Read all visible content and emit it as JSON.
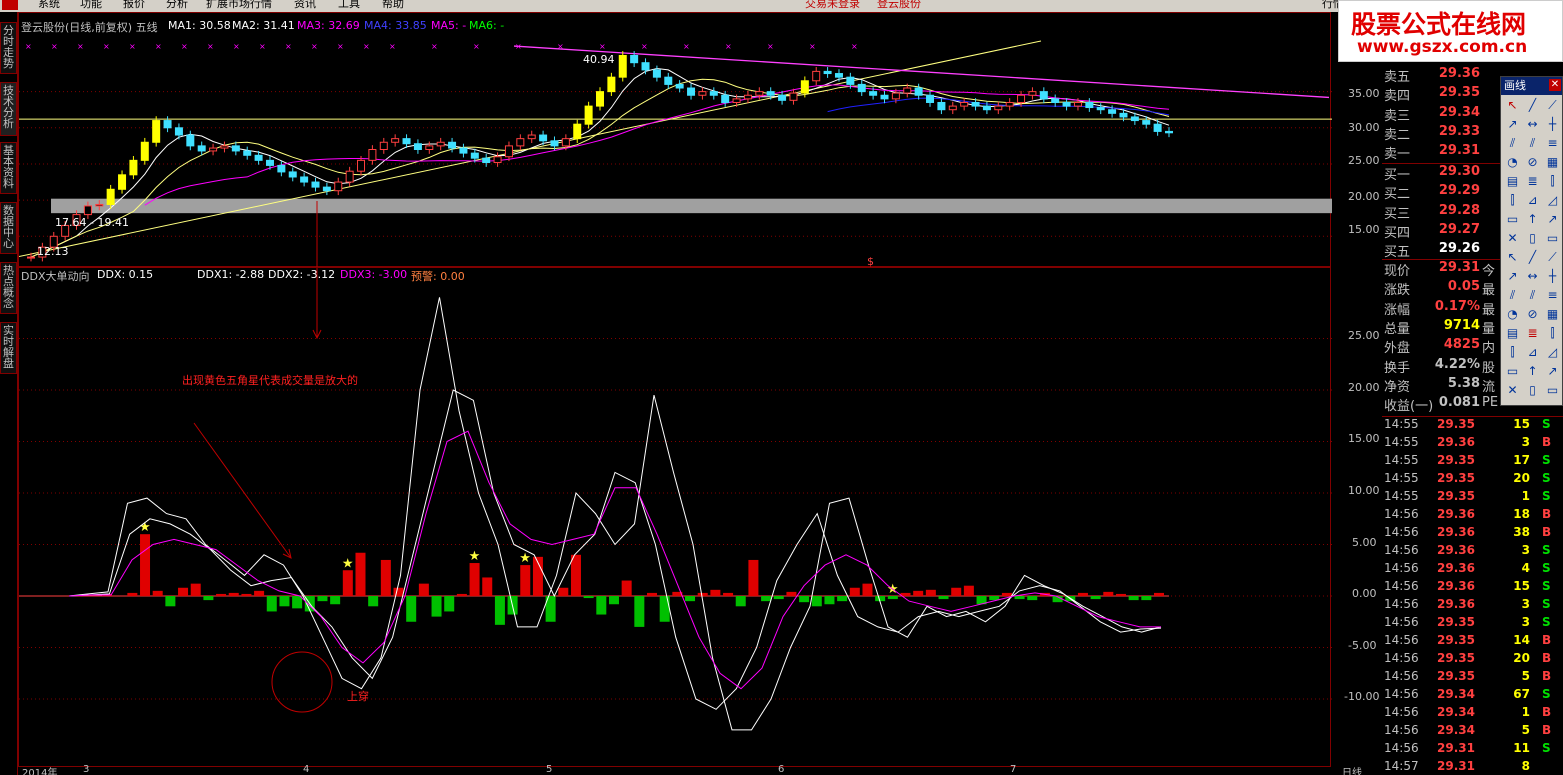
{
  "menu": [
    "系统",
    "功能",
    "报价",
    "分析",
    "扩展市场行情",
    "资讯",
    "工具",
    "帮助"
  ],
  "menu_center": [
    "交易未登录",
    "登云股份"
  ],
  "menu_right": "行情",
  "left_tabs": [
    "分时走势",
    "技术分析",
    "基本资料",
    "数据中心",
    "热点概念",
    "实时解盘"
  ],
  "main_chart": {
    "title": "登云股份(日线,前复权) 五线",
    "ma": [
      {
        "label": "MA1: 30.58",
        "color": "#ffffff"
      },
      {
        "label": "MA2: 31.41",
        "color": "#ffffff"
      },
      {
        "label": "MA3: 32.69",
        "color": "#ff00ff"
      },
      {
        "label": "MA4: 33.85",
        "color": "#0000ff"
      },
      {
        "label": "MA5: -",
        "color": "#ff00ff"
      },
      {
        "label": "MA6: -",
        "color": "#00ff00"
      }
    ],
    "y_ticks": [
      "35.00",
      "30.00",
      "25.00",
      "20.00",
      "15.00"
    ],
    "high_label": "40.94",
    "low_label": "12.13",
    "range_label_a": "17.64 - 19.41",
    "range_label_b": "20.00"
  },
  "indicator": {
    "name": "DDX大单动向",
    "ddx": "DDX: 0.15",
    "ddx1": "DDX1: -2.88",
    "ddx2": "DDX2: -3.12",
    "ddx3": "DDX3: -3.00",
    "warn": "预警: 0.00",
    "y_ticks": [
      "25.00",
      "20.00",
      "15.00",
      "10.00",
      "5.00",
      "0.00",
      "-5.00",
      "-10.00"
    ],
    "annotation": "出现黄色五角星代表成交量是放大的",
    "cross_label": "上穿"
  },
  "x_axis": [
    "2014年",
    "3",
    "4",
    "5",
    "6",
    "7"
  ],
  "x_axis_right": "日线",
  "dollar_mark": "$",
  "brand": {
    "name": "股票公式在线网",
    "url": "www.gszx.com.cn"
  },
  "drawbar_title": "画线",
  "quote": {
    "sells": [
      {
        "label": "卖五",
        "price": "29.36"
      },
      {
        "label": "卖四",
        "price": "29.35"
      },
      {
        "label": "卖三",
        "price": "29.34"
      },
      {
        "label": "卖二",
        "price": "29.33"
      },
      {
        "label": "卖一",
        "price": "29.31"
      }
    ],
    "buys": [
      {
        "label": "买一",
        "price": "29.30"
      },
      {
        "label": "买二",
        "price": "29.29"
      },
      {
        "label": "买三",
        "price": "29.28"
      },
      {
        "label": "买四",
        "price": "29.27"
      },
      {
        "label": "买五",
        "price": "29.26"
      }
    ],
    "stats": [
      {
        "label": "现价",
        "value": "29.31",
        "extra": "今",
        "color": "#ff4040"
      },
      {
        "label": "涨跌",
        "value": "0.05",
        "extra": "最",
        "color": "#ff4040"
      },
      {
        "label": "涨幅",
        "value": "0.17%",
        "extra": "最",
        "color": "#ff4040"
      },
      {
        "label": "总量",
        "value": "9714",
        "extra": "量",
        "color": "#ffff00"
      },
      {
        "label": "外盘",
        "value": "4825",
        "extra": "内",
        "color": "#ff4040"
      },
      {
        "label": "换手",
        "value": "4.22%",
        "extra": "股",
        "color": "#c0c0c0"
      },
      {
        "label": "净资",
        "value": "5.38",
        "extra": "流",
        "color": "#c0c0c0"
      },
      {
        "label": "收益(一)",
        "value": "0.081",
        "extra": "PE",
        "color": "#c0c0c0"
      }
    ],
    "ticks": [
      {
        "t": "14:55",
        "p": "29.35",
        "v": "15",
        "s": "S"
      },
      {
        "t": "14:55",
        "p": "29.36",
        "v": "3",
        "s": "B"
      },
      {
        "t": "14:55",
        "p": "29.35",
        "v": "17",
        "s": "S"
      },
      {
        "t": "14:55",
        "p": "29.35",
        "v": "20",
        "s": "S"
      },
      {
        "t": "14:55",
        "p": "29.35",
        "v": "1",
        "s": "S"
      },
      {
        "t": "14:56",
        "p": "29.36",
        "v": "18",
        "s": "B"
      },
      {
        "t": "14:56",
        "p": "29.36",
        "v": "38",
        "s": "B"
      },
      {
        "t": "14:56",
        "p": "29.36",
        "v": "3",
        "s": "S"
      },
      {
        "t": "14:56",
        "p": "29.36",
        "v": "4",
        "s": "S"
      },
      {
        "t": "14:56",
        "p": "29.36",
        "v": "15",
        "s": "S"
      },
      {
        "t": "14:56",
        "p": "29.36",
        "v": "3",
        "s": "S"
      },
      {
        "t": "14:56",
        "p": "29.35",
        "v": "3",
        "s": "S"
      },
      {
        "t": "14:56",
        "p": "29.35",
        "v": "14",
        "s": "B"
      },
      {
        "t": "14:56",
        "p": "29.35",
        "v": "20",
        "s": "B"
      },
      {
        "t": "14:56",
        "p": "29.35",
        "v": "5",
        "s": "B"
      },
      {
        "t": "14:56",
        "p": "29.34",
        "v": "67",
        "s": "S"
      },
      {
        "t": "14:56",
        "p": "29.34",
        "v": "1",
        "s": "B"
      },
      {
        "t": "14:56",
        "p": "29.34",
        "v": "5",
        "s": "B"
      },
      {
        "t": "14:56",
        "p": "29.31",
        "v": "11",
        "s": "S"
      },
      {
        "t": "14:57",
        "p": "29.31",
        "v": "8",
        "s": ""
      }
    ]
  },
  "chart_data": [
    {
      "type": "candlestick",
      "title": "登云股份(日线,前复权) 五线",
      "ylim": [
        12,
        42
      ],
      "close": [
        12.13,
        13.5,
        15.0,
        16.5,
        18.0,
        19.2,
        19.4,
        21.5,
        23.5,
        25.5,
        28.0,
        31.0,
        30.0,
        29.0,
        27.5,
        26.8,
        27.2,
        27.5,
        26.8,
        26.2,
        25.5,
        24.8,
        23.9,
        23.2,
        22.5,
        21.8,
        21.3,
        22.5,
        24.0,
        25.5,
        27.0,
        28.0,
        28.5,
        27.8,
        27.0,
        27.5,
        28.0,
        27.2,
        26.5,
        25.8,
        25.2,
        26.0,
        27.5,
        28.5,
        29.0,
        28.2,
        27.5,
        28.5,
        30.5,
        33.0,
        35.0,
        37.0,
        40.0,
        39.0,
        38.0,
        37.0,
        36.0,
        35.5,
        34.5,
        35.0,
        34.5,
        33.5,
        34.0,
        34.5,
        35.0,
        34.5,
        33.8,
        34.8,
        36.5,
        37.8,
        37.5,
        37.0,
        36.0,
        35.0,
        34.5,
        34.0,
        34.8,
        35.5,
        34.5,
        33.5,
        32.5,
        33.0,
        33.5,
        33.0,
        32.5,
        33.0,
        33.5,
        34.5,
        35.0,
        34.0,
        33.5,
        33.0,
        33.5,
        32.8,
        32.5,
        32.0,
        31.5,
        31.0,
        30.5,
        29.5,
        29.31
      ],
      "ma_labels": [
        "MA1: 30.58",
        "MA2: 31.41",
        "MA3: 32.69",
        "MA4: 33.85",
        "MA5: -",
        "MA6: -"
      ]
    },
    {
      "type": "bar",
      "title": "DDX大单动向",
      "ylim": [
        -16,
        30
      ],
      "values": [
        0.2,
        0,
        0.3,
        6.0,
        0.5,
        -1.0,
        0.8,
        1.2,
        -0.4,
        0.2,
        0.3,
        0.2,
        0.5,
        -1.5,
        -1.0,
        -1.2,
        -1.5,
        -0.5,
        -0.8,
        2.5,
        4.2,
        -1.0,
        3.5,
        0.8,
        -2.5,
        1.2,
        -2.0,
        -1.5,
        0.2,
        3.2,
        1.8,
        -2.8,
        -1.8,
        3.0,
        3.8,
        -2.5,
        0.8,
        4.0,
        -0.2,
        -1.8,
        -0.8,
        1.5,
        -3.0,
        0.3,
        -2.5,
        0.4,
        -0.5,
        0.3,
        0.6,
        0.3,
        -1.0,
        3.5,
        -0.5,
        -0.3,
        0.4,
        -0.6,
        -1.0,
        -0.8,
        -0.5,
        0.8,
        1.2,
        -0.5,
        -0.3,
        0.3,
        0.5,
        0.6,
        -0.3,
        0.8,
        1.0,
        -0.8,
        -0.4,
        0.3,
        -0.3,
        -0.4,
        0.3,
        -0.6,
        -0.5,
        0.3,
        -0.3,
        0.4,
        0.2,
        -0.4,
        -0.4,
        0.3
      ],
      "stars": [
        3,
        19,
        29,
        33,
        62
      ],
      "lines": {
        "DDX1": [
          0,
          0.2,
          0.4,
          9.0,
          9.5,
          8.0,
          7.5,
          5.0,
          3.5,
          2.0,
          4.0,
          3.0,
          0,
          -4.0,
          -8.0,
          -9.0,
          -6.0,
          2.0,
          20.0,
          29.0,
          18.0,
          10.0,
          5.0,
          -3.0,
          -3.0,
          2.0,
          10.0,
          8.0,
          5.0,
          7.0,
          19.5,
          12.0,
          5.0,
          -6.0,
          -13.0,
          -13.0,
          -10.0,
          -5.0,
          -1.0,
          9.0,
          9.5,
          3.0,
          -3.0,
          -4.0,
          -1.0,
          -2.0,
          -1.5,
          -2.5,
          -1.0,
          2.0,
          1.0,
          0.2,
          -1.0,
          -2.0,
          -3.0,
          -3.5,
          -3.0
        ],
        "DDX2": [
          0,
          0.1,
          0.2,
          6.0,
          7.5,
          7.0,
          6.0,
          4.5,
          2.5,
          1.0,
          1.5,
          1.8,
          -1.0,
          -3.0,
          -6.0,
          -8.0,
          -4.0,
          4.0,
          12.0,
          20.0,
          19.0,
          10.0,
          5.0,
          4.0,
          0,
          4.0,
          6.0,
          12.0,
          11.0,
          5.0,
          -4.0,
          -10.0,
          -11.0,
          -9.0,
          -5.0,
          1.5,
          5.0,
          8.0,
          2.0,
          -2.0,
          -3.0,
          -3.5,
          -2.0,
          -1.5,
          -2.0,
          -1.5,
          -1.0,
          0.5,
          1.0,
          0.5,
          -1.0,
          -2.5,
          -3.5,
          -3.2,
          -3.12
        ],
        "DDX3": [
          0,
          0.1,
          0.1,
          3.5,
          5.0,
          5.5,
          5.0,
          4.5,
          3.0,
          1.5,
          0.5,
          0,
          -2.0,
          -5.0,
          -6.5,
          -4.5,
          0,
          8.0,
          15.0,
          16.0,
          11.0,
          7.0,
          5.5,
          5.0,
          5.5,
          6.0,
          10.5,
          10.5,
          6.0,
          1.0,
          -4.0,
          -7.5,
          -9.0,
          -7.0,
          -2.0,
          1.0,
          3.0,
          4.0,
          3.0,
          1.0,
          -0.5,
          -1.0,
          -1.5,
          -1.0,
          -0.5,
          0,
          0.3,
          0,
          -1.0,
          -2.0,
          -2.5,
          -3.0,
          -3.0
        ]
      }
    }
  ]
}
